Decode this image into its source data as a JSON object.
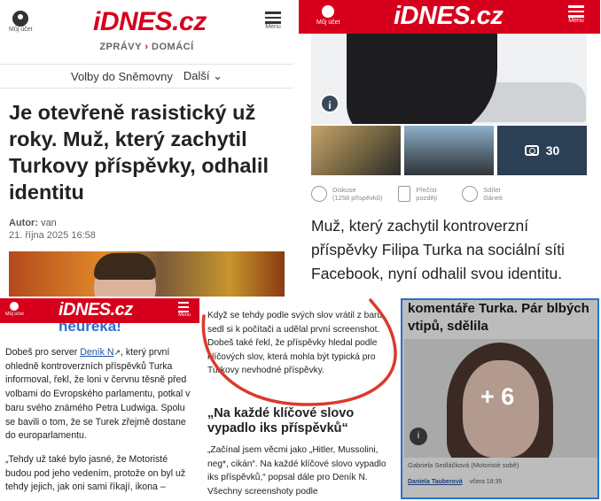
{
  "panel_a": {
    "account_label": "Můj účet",
    "logo": "iDNES.cz",
    "menu_label": "Menu",
    "breadcrumb": {
      "section": "ZPRÁVY",
      "separator": "›",
      "subsection": "DOMÁCÍ"
    },
    "subnav": {
      "item": "Volby do Sněmovny",
      "more": "Další ⌄"
    },
    "title": "Je otevřeně rasistický už roky. Muž, který zachytil Turkovy příspěvky, odhalil identitu",
    "author_label": "Autor:",
    "author_name": "van",
    "date": "21. října 2025  16:58"
  },
  "panel_b": {
    "account_label": "Můj účet",
    "logo": "iDNES.cz",
    "menu_label": "Menu",
    "photo_count": "30",
    "actions": {
      "discussion": "Diskuse",
      "discussion_count": "(1258 příspěvků)",
      "read_later": "Přečíst později",
      "share": "Sdílet článek"
    },
    "lead": "Muž, který zachytil kontroverzní příspěvky Filipa Turka na sociální síti Facebook, nyní odhalil svou identitu."
  },
  "panel_c": {
    "account_label": "Můj účet",
    "logo": "iDNES.cz",
    "menu_label": "Menu",
    "partner": "heureka!",
    "para1_before": "Dobeš pro server ",
    "para1_link": "Deník N",
    "para1_after": ", který první ohledně kontroverzních příspěvků Turka informoval, řekl, že loni v červnu těsně před volbami do Evropského parlamentu, potkal v baru svého známého Petra Ludwiga. Spolu se bavili o tom, že se Turek zřejmě dostane do europarlamentu.",
    "para2": "„Tehdy už také bylo jasné, že Motoristé budou pod jeho vedením, protože on byl už tehdy jejich, jak oni sami říkají, ikona –"
  },
  "panel_d": {
    "para1": "Když se tehdy podle svých slov vrátil z baru, sedl si k počítači a udělal první screenshot. Dobeš také řekl, že příspěvky hledal podle klíčových slov, která mohla být typická pro Turkovy nevhodné příspěvky.",
    "heading": "„Na každé klíčové slovo vypadlo iks příspěvků“",
    "para2": "„Začínal jsem věcmi jako „Hitler, Mussolini, neg*, cikán“. Na každé klíčové slovo vypadlo iks příspěvků,“ popsal dále pro Deník N. Všechny screenshoty podle"
  },
  "panel_e": {
    "top_text": "komentáře Turka. Pár blbých vtipů, sdělila",
    "more_photos": "+ 6",
    "caption": "Gabriela Sedláčková (Motoristé sobě)",
    "author": "Daniela Tauberová",
    "time": "včera 18:35"
  }
}
